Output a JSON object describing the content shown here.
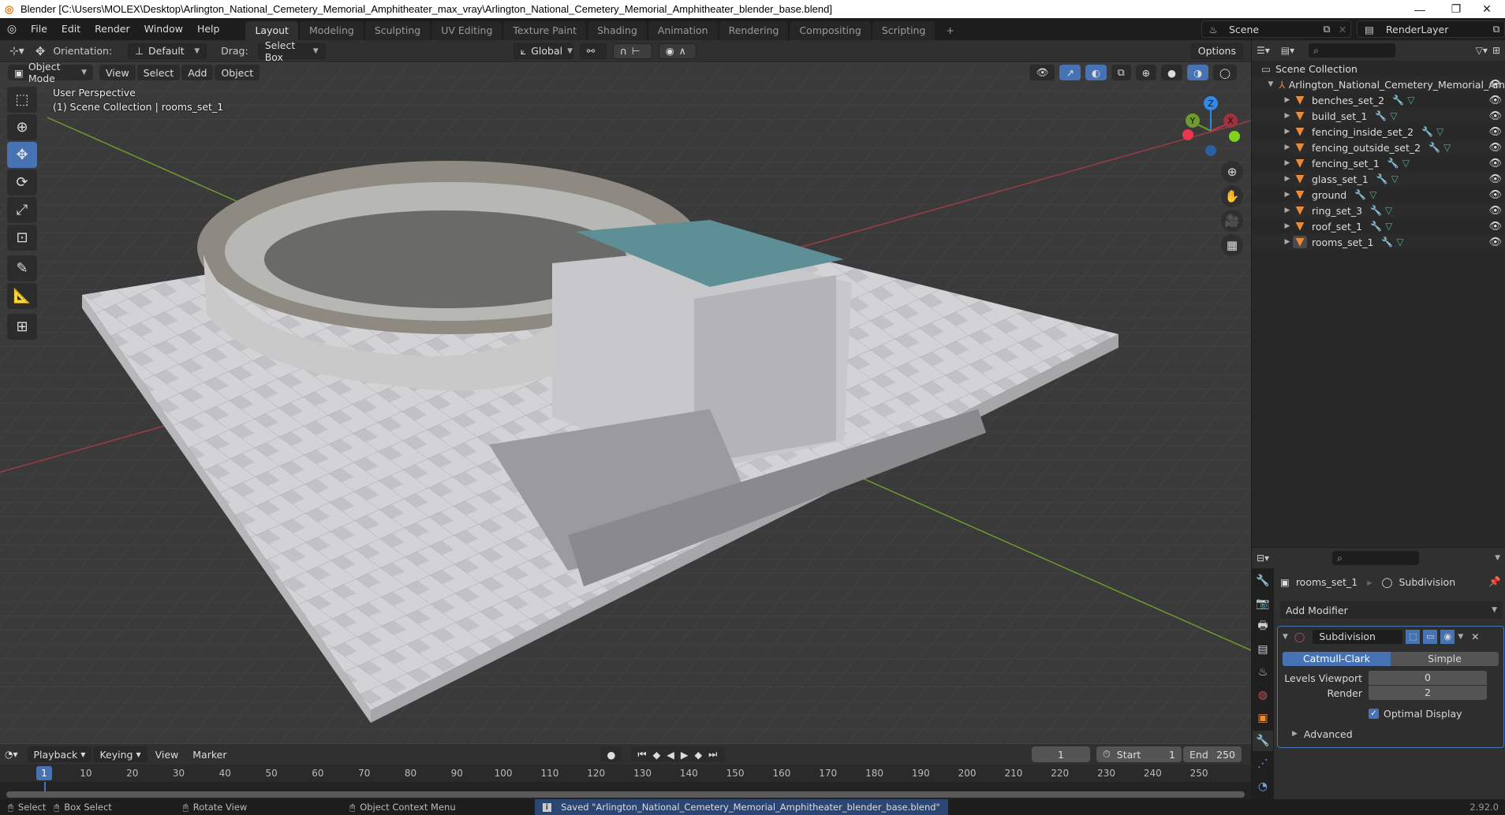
{
  "window": {
    "title": "Blender [C:\\Users\\MOLEX\\Desktop\\Arlington_National_Cemetery_Memorial_Amphitheater_max_vray\\Arlington_National_Cemetery_Memorial_Amphitheater_blender_base.blend]",
    "controls": {
      "minimize": "—",
      "maximize": "❐",
      "close": "✕"
    }
  },
  "menubar": {
    "items": [
      "File",
      "Edit",
      "Render",
      "Window",
      "Help"
    ],
    "workspaces": [
      "Layout",
      "Modeling",
      "Sculpting",
      "UV Editing",
      "Texture Paint",
      "Shading",
      "Animation",
      "Rendering",
      "Compositing",
      "Scripting"
    ],
    "active_workspace": "Layout",
    "add_workspace": "+",
    "scene": "Scene",
    "view_layer": "RenderLayer"
  },
  "tool_header": {
    "orientation_label": "Orientation:",
    "orientation_value": "Default",
    "drag_label": "Drag:",
    "drag_value": "Select Box",
    "transform_orientation": "Global",
    "options": "Options"
  },
  "viewport": {
    "mode": "Object Mode",
    "menus": [
      "View",
      "Select",
      "Add",
      "Object"
    ],
    "perspective": "User Perspective",
    "collection_info": "(1) Scene Collection | rooms_set_1",
    "gizmo": {
      "x": "X",
      "y": "Y",
      "z": "Z"
    },
    "colors": {
      "x_axis": "#c4384a",
      "y_axis": "#86b53a",
      "z_axis": "#2e8ae6",
      "grid": "#494949",
      "bg": "#3b3b3b"
    },
    "tools": [
      "select-box",
      "cursor",
      "move",
      "rotate",
      "scale",
      "transform",
      "annotate",
      "measure",
      "add-cube"
    ],
    "active_tool": "move"
  },
  "outliner": {
    "root": "Scene Collection",
    "collection": "Arlington_National_Cemetery_Memorial_Am",
    "objects": [
      {
        "name": "benches_set_2"
      },
      {
        "name": "build_set_1"
      },
      {
        "name": "fencing_inside_set_2"
      },
      {
        "name": "fencing_outside_set_2"
      },
      {
        "name": "fencing_set_1"
      },
      {
        "name": "glass_set_1"
      },
      {
        "name": "ground"
      },
      {
        "name": "ring_set_3"
      },
      {
        "name": "roof_set_1"
      },
      {
        "name": "rooms_set_1",
        "active": true
      }
    ]
  },
  "properties": {
    "object": "rooms_set_1",
    "modifier_breadcrumb": "Subdivision",
    "add_modifier": "Add Modifier",
    "modifier": {
      "name": "Subdivision",
      "type_options": [
        "Catmull-Clark",
        "Simple"
      ],
      "selected_type": "Catmull-Clark",
      "levels_viewport_label": "Levels Viewport",
      "levels_viewport": "0",
      "render_label": "Render",
      "render": "2",
      "optimal_display_label": "Optimal Display",
      "optimal_display": true,
      "advanced": "Advanced"
    }
  },
  "timeline": {
    "menus": [
      "Playback",
      "Keying",
      "View",
      "Marker"
    ],
    "current_frame": "1",
    "start_label": "Start",
    "start": "1",
    "end_label": "End",
    "end": "250",
    "ticks": [
      "10",
      "20",
      "30",
      "40",
      "50",
      "60",
      "70",
      "80",
      "90",
      "100",
      "110",
      "120",
      "130",
      "140",
      "150",
      "160",
      "170",
      "180",
      "190",
      "200",
      "210",
      "220",
      "230",
      "240",
      "250"
    ]
  },
  "statusbar": {
    "select": "Select",
    "box_select": "Box Select",
    "rotate_view": "Rotate View",
    "context_menu": "Object Context Menu",
    "message": "Saved \"Arlington_National_Cemetery_Memorial_Amphitheater_blender_base.blend\"",
    "version": "2.92.0"
  }
}
